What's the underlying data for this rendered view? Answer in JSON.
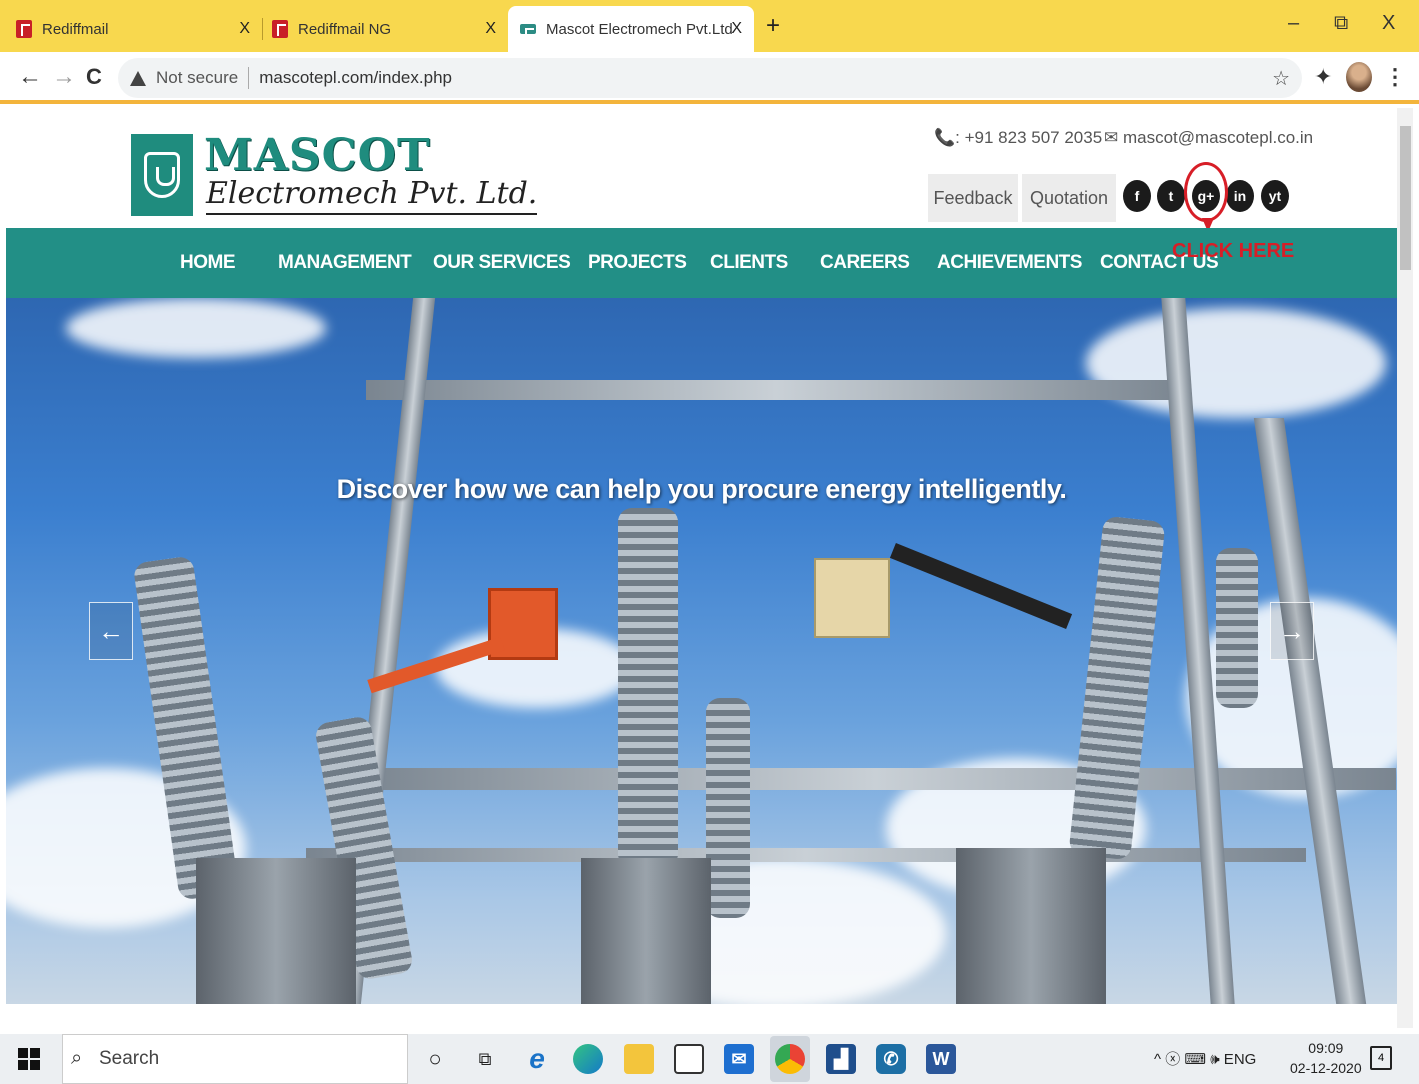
{
  "browser": {
    "tabs": [
      {
        "title": "Rediffmail",
        "close": "X"
      },
      {
        "title": "Rediffmail NG",
        "close": "X"
      },
      {
        "title": "Mascot Electromech Pvt.Ltd",
        "close": "X"
      }
    ],
    "new_tab": "+",
    "window_controls": {
      "minimize": "–",
      "restore": "⧉",
      "close": "X"
    },
    "nav": {
      "back": "←",
      "forward": "→",
      "reload": "C"
    },
    "security_label": "Not secure",
    "url": "mascotepl.com/index.php",
    "bookmark_icon": "☆",
    "extensions_icon": "✦",
    "menu_icon": "⋮"
  },
  "site": {
    "brand_name": "MASCOT",
    "brand_sub": "Electromech Pvt. Ltd.",
    "phone": "📞: +91 823 507 2035",
    "email": "✉ mascot@mascotepl.co.in",
    "buttons": {
      "feedback": "Feedback",
      "quotation": "Quotation"
    },
    "social": [
      "f",
      "t",
      "g+",
      "in",
      "yt"
    ],
    "annotation": "CLICK HERE",
    "nav": [
      "HOME",
      "MANAGEMENT",
      "OUR SERVICES",
      "PROJECTS",
      "CLIENTS",
      "CAREERS",
      "ACHIEVEMENTS",
      "CONTACT US"
    ],
    "hero_caption": "Discover how we can help you procure energy intelligently.",
    "prev_arrow": "←",
    "next_arrow": "→"
  },
  "taskbar": {
    "search_placeholder": "Search",
    "tray": "^ ⓧ ⌨ 🕪 ENG",
    "time": "09:09",
    "date": "02-12-2020",
    "notifications": "4",
    "apps": [
      "cortana",
      "task-view",
      "edge-legacy",
      "edge",
      "file-explorer",
      "store",
      "mail",
      "chrome",
      "analytics",
      "whatsapp",
      "word"
    ]
  },
  "colors": {
    "brand_teal": "#228f86",
    "tab_yellow": "#f8d84e",
    "accent_red": "#d71e27"
  }
}
